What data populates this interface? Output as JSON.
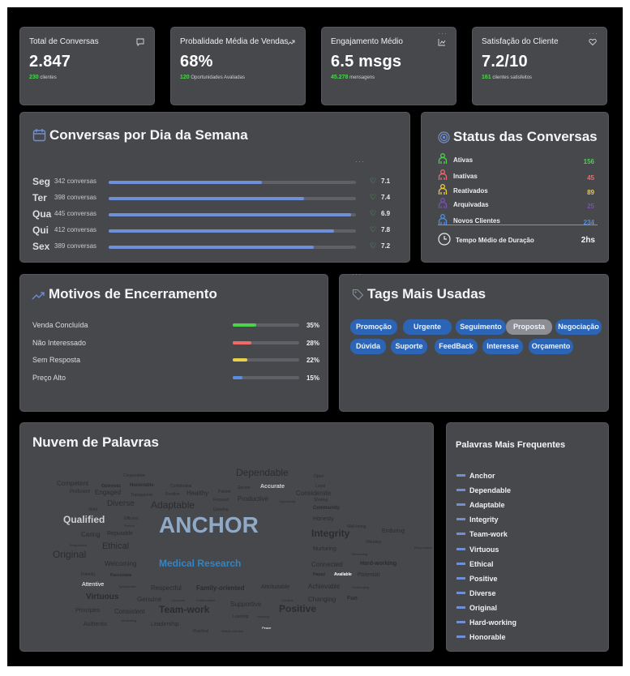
{
  "kpis": [
    {
      "title": "Total de Conversas",
      "icon": "chat-icon",
      "value": "2.847",
      "sub_value": "230",
      "sub_label": "clientes"
    },
    {
      "title": "Probalidade Média de Vendas",
      "icon": "trend-up-icon",
      "value": "68%",
      "sub_value": "120",
      "sub_label": "Oportunidades Avaliadas"
    },
    {
      "title": "Engajamento Médio",
      "icon": "chart-icon",
      "value": "6.5 msgs",
      "sub_value": "45.278",
      "sub_label": "mensagens"
    },
    {
      "title": "Satisfação do Cliente",
      "icon": "heart-icon",
      "value": "7.2/10",
      "sub_value": "161",
      "sub_label": "clientes satisfeitos"
    }
  ],
  "weekday": {
    "title": "Conversas por Dia da Semana",
    "rows": [
      {
        "day": "Seg",
        "count": "342 conversas",
        "fill": 0.62,
        "score": "7.1"
      },
      {
        "day": "Ter",
        "count": "398 conversas",
        "fill": 0.79,
        "score": "7.4"
      },
      {
        "day": "Qua",
        "count": "445 conversas",
        "fill": 0.98,
        "score": "6.9"
      },
      {
        "day": "Qui",
        "count": "412 conversas",
        "fill": 0.91,
        "score": "7.8"
      },
      {
        "day": "Sex",
        "count": "389 conversas",
        "fill": 0.83,
        "score": "7.2"
      }
    ]
  },
  "status": {
    "title": "Status das Conversas",
    "rows": [
      {
        "label": "Ativas",
        "value": "156",
        "color": "#4ed24e"
      },
      {
        "label": "Inativas",
        "value": "45",
        "color": "#f06a6a"
      },
      {
        "label": "Reativados",
        "value": "89",
        "color": "#f0c93a"
      },
      {
        "label": "Arquivadas",
        "value": "25",
        "color": "#7c4fb3"
      },
      {
        "label": "Novos Clientes",
        "value": "234",
        "color": "#4f8fe0"
      }
    ],
    "duration_label": "Tempo Médio de Duração",
    "duration_value": "2hs"
  },
  "reasons": {
    "title": "Motivos de Encerramento",
    "rows": [
      {
        "label": "Venda Concluída",
        "pct": "35%",
        "fill": 0.35,
        "color": "#4ed24e"
      },
      {
        "label": "Não Interessado",
        "pct": "28%",
        "fill": 0.28,
        "color": "#f06a6a"
      },
      {
        "label": "Sem Resposta",
        "pct": "22%",
        "fill": 0.22,
        "color": "#e8d24a"
      },
      {
        "label": "Preço Alto",
        "pct": "15%",
        "fill": 0.15,
        "color": "#5a8fe0"
      }
    ]
  },
  "tags": {
    "title": "Tags Mais Usadas",
    "items": [
      "Promoção",
      "Urgente",
      "Seguimento",
      "Proposta",
      "Negociação",
      "Dúvida",
      "Suporte",
      "FeedBack",
      "Interesse",
      "Orçamento"
    ],
    "selected": "Proposta"
  },
  "cloud": {
    "title": "Nuvem de Palavras",
    "words": [
      "Dependable",
      "Cooperative",
      "Competent",
      "Honorable",
      "Optimistic",
      "Proficient",
      "Engaged",
      "Confidential",
      "Transparent",
      "Positive",
      "Healthy",
      "Patient",
      "Secure",
      "Accurate",
      "Open",
      "Loyal",
      "Considerate",
      "Diverse",
      "Adaptable",
      "Productive",
      "Focused",
      "Opportunity",
      "Sharing",
      "Community",
      "Bold",
      "Qualified",
      "Efficient",
      "Service",
      "Growing",
      "Honesty",
      "Well-being",
      "Caring",
      "Reputable",
      "ANCHOR",
      "Integrity",
      "Enduring",
      "Progressive",
      "Ethical",
      "Vibrancy",
      "Responsible",
      "Original",
      "Nurturing",
      "Rewarding",
      "Welcoming",
      "Medical Research",
      "Connected",
      "Hard-working",
      "Friendly",
      "Passionate",
      "Happy",
      "Available",
      "Potential",
      "Attentive",
      "Sympathetic",
      "Respectful",
      "Family-oriented",
      "Attributable",
      "Achievable",
      "Challenging",
      "Virtuous",
      "Genuine",
      "Licensed",
      "Collaborative",
      "Supportive",
      "Credible",
      "Changing",
      "Fun",
      "Principles",
      "Consistent",
      "Team-work",
      "Positive",
      "Learning",
      "Inspiring",
      "Authentic",
      "Motivating",
      "Leadership",
      "Practical",
      "Result-oriented",
      "Peace"
    ]
  },
  "frequent": {
    "title": "Palavras Mais Frequentes",
    "items": [
      "Anchor",
      "Dependable",
      "Adaptable",
      "Integrity",
      "Team-work",
      "Virtuous",
      "Ethical",
      "Positive",
      "Diverse",
      "Original",
      "Hard-working",
      "Honorable"
    ]
  },
  "colors": {
    "accent_blue": "#6f8fd8",
    "green": "#4ed24e",
    "card": "#46484c"
  }
}
